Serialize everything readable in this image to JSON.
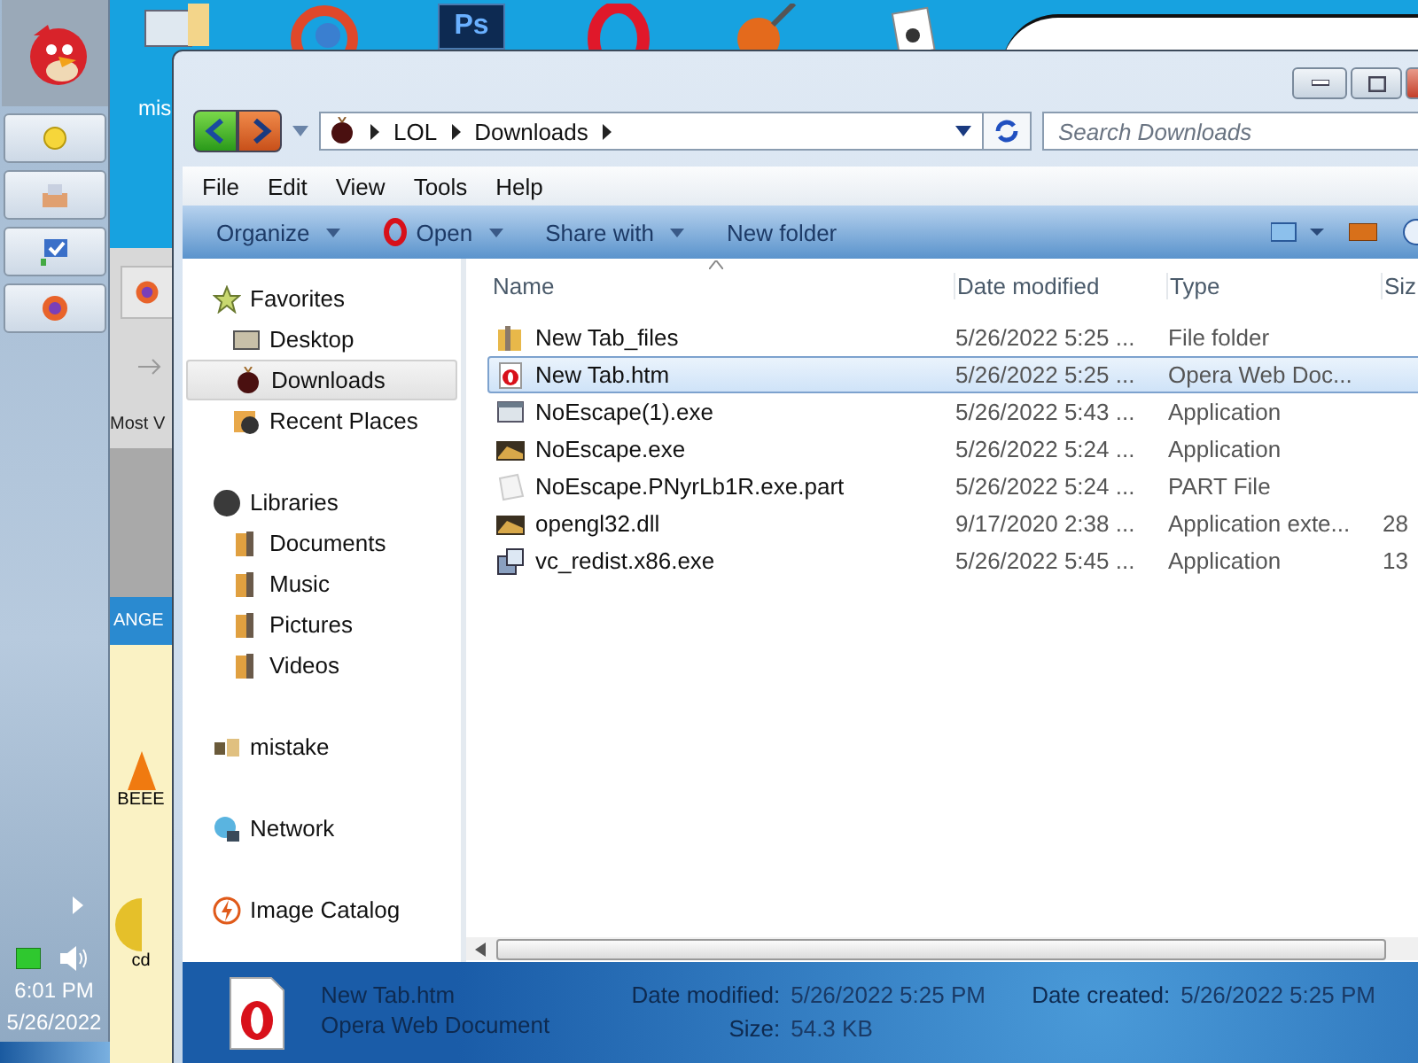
{
  "desktop": {
    "icons": [
      {
        "kind": "program"
      },
      {
        "kind": "browser"
      },
      {
        "kind": "photoshop",
        "glyph": "Ps"
      },
      {
        "kind": "opera"
      },
      {
        "kind": "ball"
      },
      {
        "kind": "cards"
      }
    ],
    "icon_label": "mis"
  },
  "taskbar": {
    "buttons": [
      {
        "kind": "sun"
      },
      {
        "kind": "tools"
      },
      {
        "kind": "monitor"
      },
      {
        "kind": "firefox"
      }
    ],
    "time": "6:01 PM",
    "date": "5/26/2022"
  },
  "background_window": {
    "browser_text": "Most V",
    "banner_text": "ANGE",
    "icon_labels": [
      "BEEE",
      "cd"
    ]
  },
  "explorer": {
    "address": [
      "LOL",
      "Downloads"
    ],
    "search": {
      "placeholder": "Search Downloads"
    },
    "menu": [
      "File",
      "Edit",
      "View",
      "Tools",
      "Help"
    ],
    "toolbar": [
      {
        "label": "Organize",
        "kind": "plain",
        "dropdown": true
      },
      {
        "label": "Open",
        "kind": "opera",
        "dropdown": true
      },
      {
        "label": "Share with",
        "kind": "plain",
        "dropdown": true
      },
      {
        "label": "New folder",
        "kind": "plain",
        "dropdown": false
      }
    ],
    "nav": [
      {
        "label": "Favorites",
        "kind": "star",
        "selected": false,
        "children": [
          {
            "label": "Desktop",
            "kind": "desktop",
            "selected": false
          },
          {
            "label": "Downloads",
            "kind": "bug",
            "selected": true
          },
          {
            "label": "Recent Places",
            "kind": "recent",
            "selected": false
          }
        ]
      },
      {
        "label": "Libraries",
        "kind": "disc",
        "selected": false,
        "children": [
          {
            "label": "Documents",
            "kind": "library",
            "selected": false
          },
          {
            "label": "Music",
            "kind": "library",
            "selected": false
          },
          {
            "label": "Pictures",
            "kind": "library",
            "selected": false
          },
          {
            "label": "Videos",
            "kind": "library",
            "selected": false
          }
        ]
      },
      {
        "label": "mistake",
        "kind": "homegroup",
        "selected": false
      },
      {
        "label": "Network",
        "kind": "network",
        "selected": false
      },
      {
        "label": "Image Catalog",
        "kind": "catalog",
        "selected": false
      }
    ],
    "columns": [
      "Name",
      "Date modified",
      "Type",
      "Siz"
    ],
    "files": [
      {
        "name": "New Tab_files",
        "date": "5/26/2022 5:25 ...",
        "type": "File folder",
        "kind": "folder",
        "selected": false
      },
      {
        "name": "New Tab.htm",
        "date": "5/26/2022 5:25 ...",
        "type": "Opera Web Doc...",
        "kind": "opera",
        "selected": true
      },
      {
        "name": "NoEscape(1).exe",
        "date": "5/26/2022 5:43 ...",
        "type": "Application",
        "kind": "window",
        "selected": false
      },
      {
        "name": "NoEscape.exe",
        "date": "5/26/2022 5:24 ...",
        "type": "Application",
        "kind": "picture",
        "selected": false
      },
      {
        "name": "NoEscape.PNyrLb1R.exe.part",
        "date": "5/26/2022 5:24 ...",
        "type": "PART File",
        "kind": "blank",
        "selected": false
      },
      {
        "name": "opengl32.dll",
        "date": "9/17/2020 2:38 ...",
        "type": "Application exte...",
        "size": "28",
        "kind": "picture",
        "selected": false
      },
      {
        "name": "vc_redist.x86.exe",
        "date": "5/26/2022 5:45 ...",
        "type": "Application",
        "size": "13",
        "kind": "installer",
        "selected": false
      }
    ],
    "details": {
      "name": "New Tab.htm",
      "type": "Opera Web Document",
      "fields": [
        {
          "label": "Date modified:",
          "value": "5/26/2022 5:25 PM"
        },
        {
          "label": "Size:",
          "value": "54.3 KB"
        },
        {
          "label": "Date created:",
          "value": "5/26/2022 5:25 PM"
        }
      ]
    }
  }
}
